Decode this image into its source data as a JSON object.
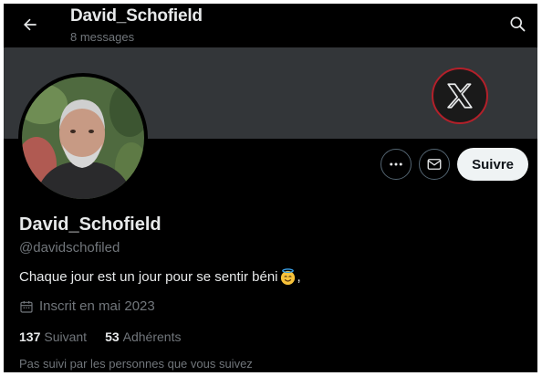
{
  "header": {
    "title": "David_Schofield",
    "subtitle": "8 messages"
  },
  "profile": {
    "name": "David_Schofield",
    "handle": "@davidschofiled",
    "bio": "Chaque jour est un jour pour se sentir béni",
    "bio_suffix": ",",
    "joined": "Inscrit en mai 2023",
    "following_count": "137",
    "following_label": "Suivant",
    "followers_count": "53",
    "followers_label": "Adhérents",
    "followers_note": "Pas suivi par les personnes que vous suivez"
  },
  "actions": {
    "follow_label": "Suivre"
  },
  "icons": [
    "back-arrow-icon",
    "search-icon",
    "x-logo-icon",
    "more-icon",
    "mail-icon",
    "calendar-icon",
    "smiling-halo-emoji-icon"
  ],
  "colors": {
    "background": "#000000",
    "banner": "#333639",
    "text_primary": "#e7e9ea",
    "text_secondary": "#71767b",
    "follow_button_bg": "#eff3f4",
    "logo_ring": "#b3202a"
  }
}
